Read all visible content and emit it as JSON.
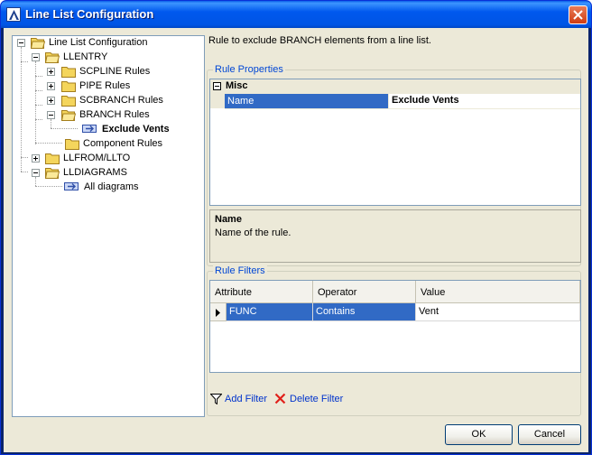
{
  "window": {
    "title": "Line List Configuration"
  },
  "tree": {
    "root": "Line List Configuration",
    "llentry": "LLENTRY",
    "scpline_rules": "SCPLINE Rules",
    "pipe_rules": "PIPE Rules",
    "scbranch_rules": "SCBRANCH Rules",
    "branch_rules": "BRANCH Rules",
    "exclude_vents": "Exclude Vents",
    "component_rules": "Component Rules",
    "llfrom_llto": "LLFROM/LLTO",
    "lldiagrams": "LLDIAGRAMS",
    "all_diagrams": "All diagrams"
  },
  "description": "Rule to exclude BRANCH elements from a line list.",
  "rule_properties": {
    "group_title": "Rule Properties",
    "category": "Misc",
    "property_name": "Name",
    "property_value": "Exclude Vents",
    "help_title": "Name",
    "help_text": "Name of the rule."
  },
  "rule_filters": {
    "group_title": "Rule Filters",
    "columns": {
      "attribute": "Attribute",
      "operator": "Operator",
      "value": "Value"
    },
    "rows": [
      {
        "attribute": "FUNC",
        "operator": "Contains",
        "value": "Vent"
      }
    ],
    "add_filter": "Add Filter",
    "delete_filter": "Delete Filter"
  },
  "buttons": {
    "ok": "OK",
    "cancel": "Cancel"
  },
  "colors": {
    "selection": "#316ac5",
    "group_title": "#0046d5",
    "folder": "#f4d55c"
  }
}
